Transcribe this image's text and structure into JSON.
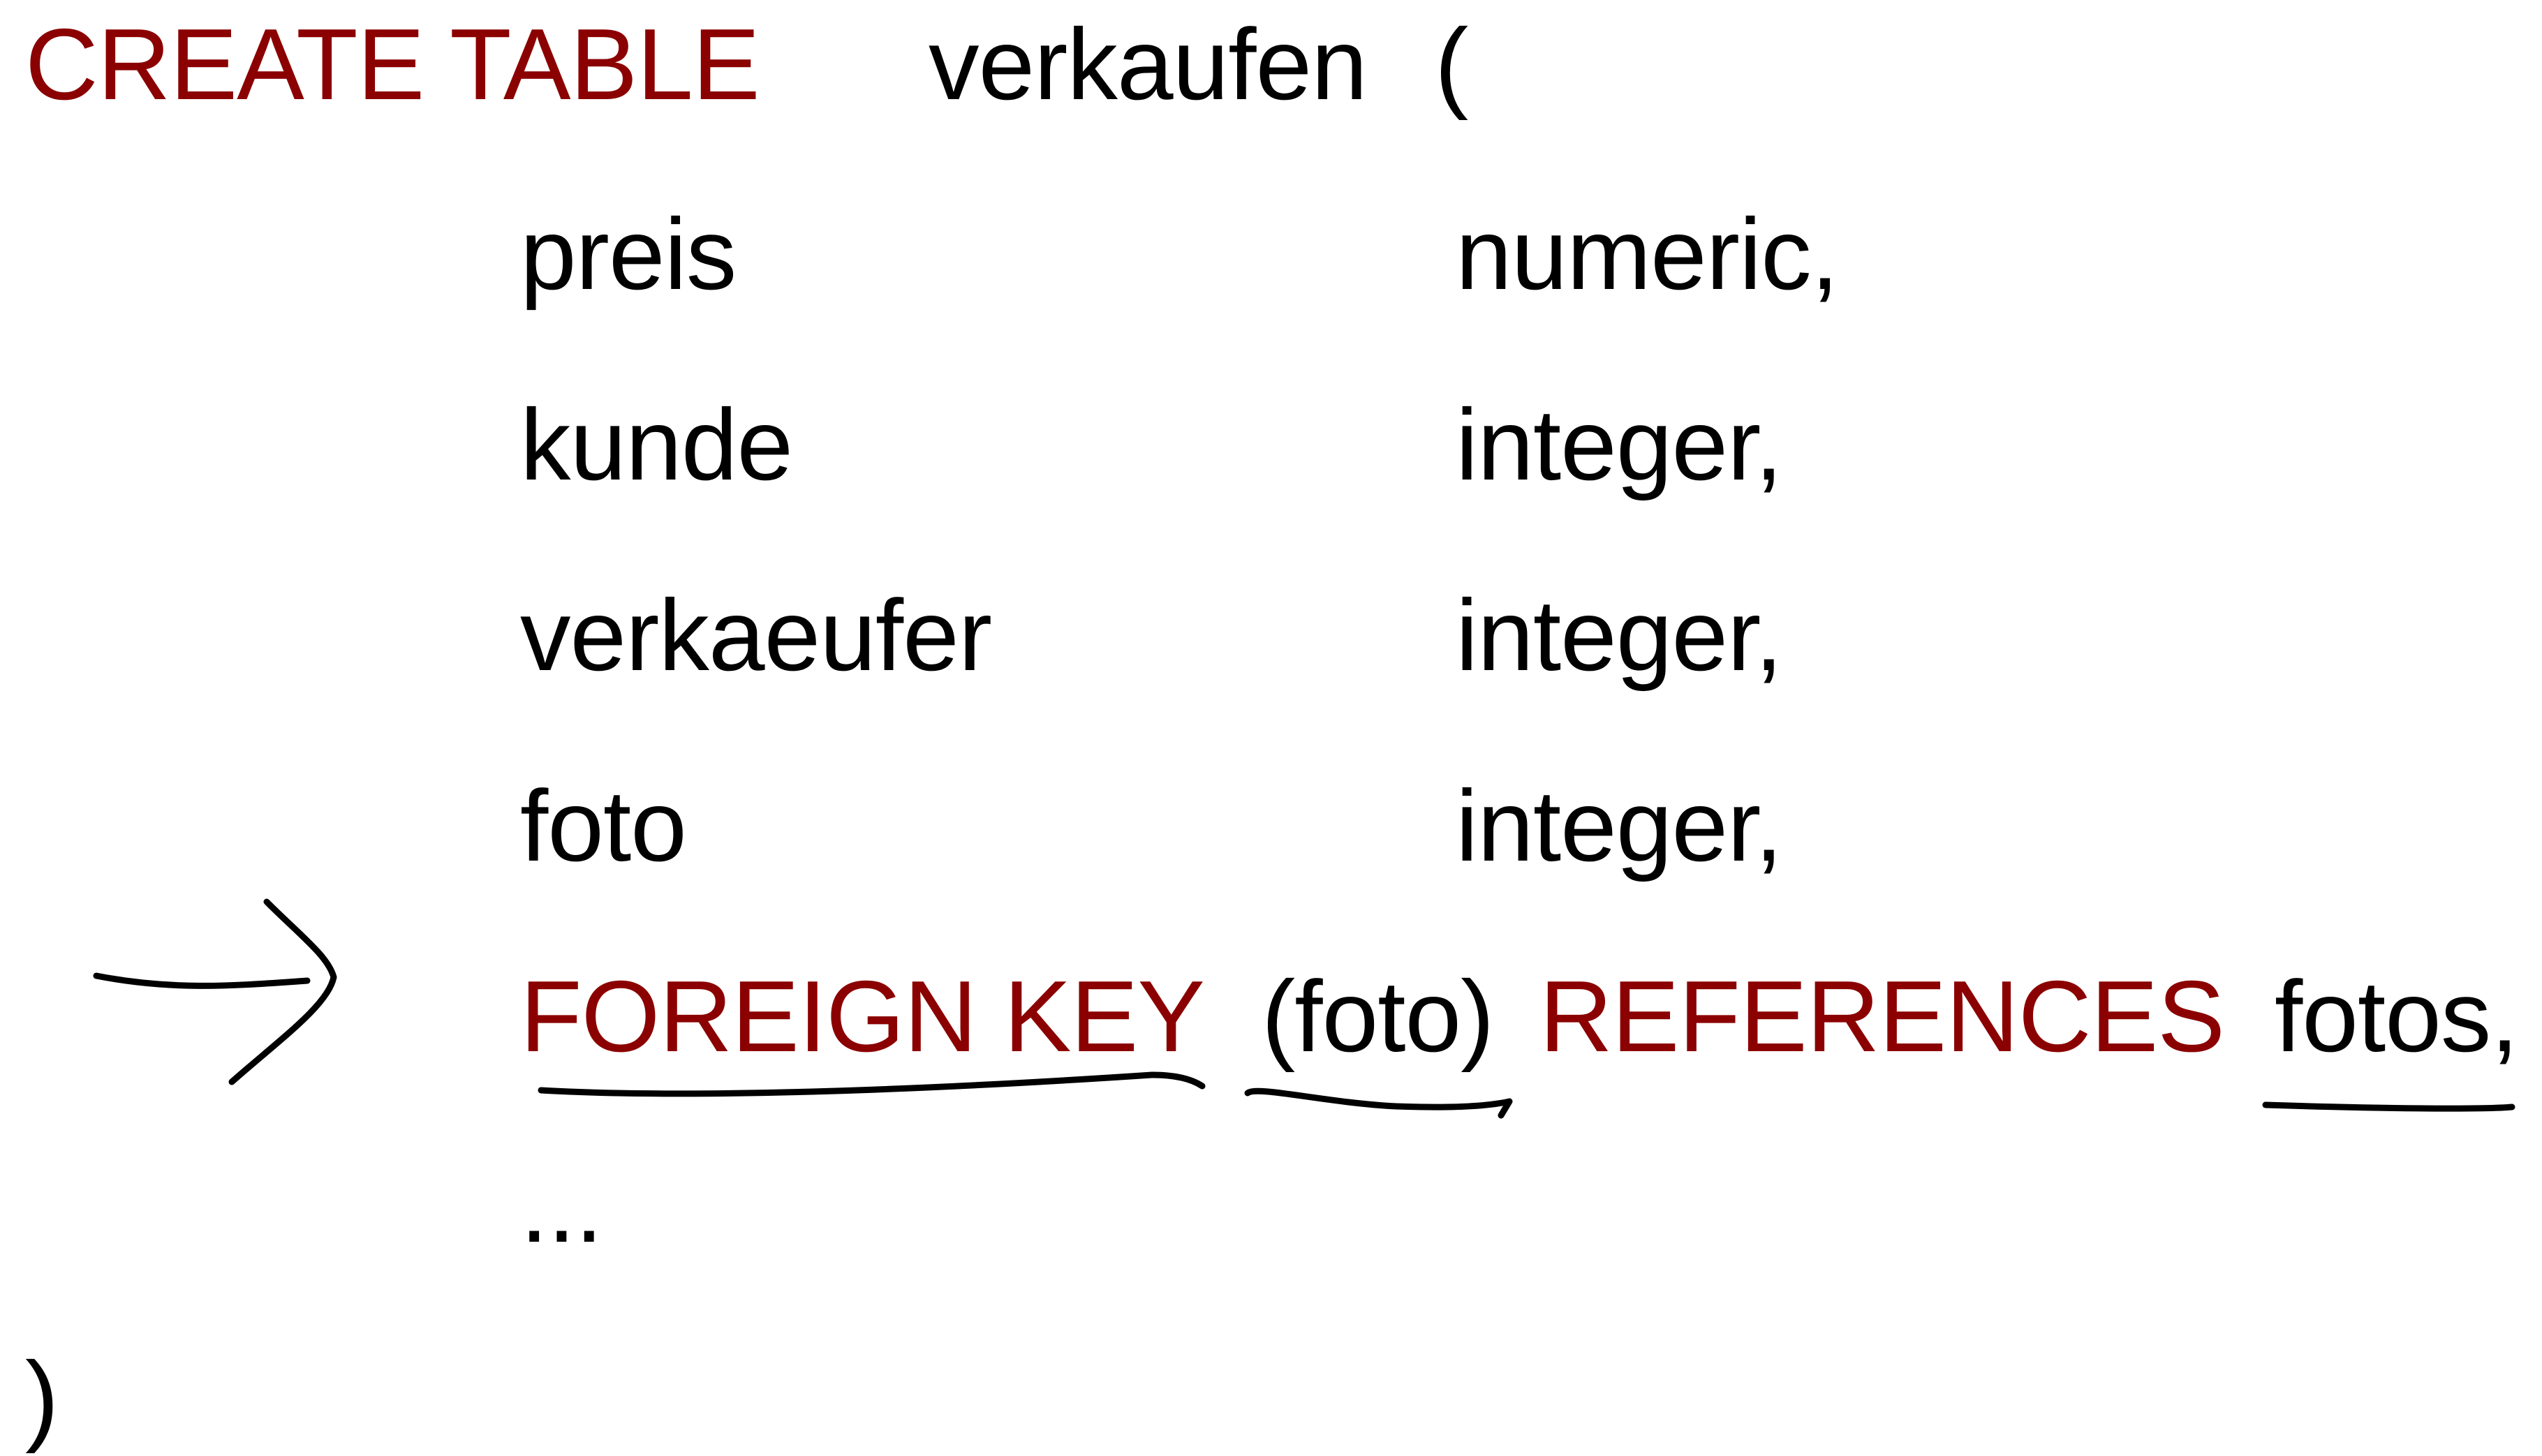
{
  "colors": {
    "keyword": "#8b0000",
    "text": "#000000",
    "background": "#ffffff",
    "ink": "#000000"
  },
  "sql": {
    "create_table_keyword": "CREATE TABLE",
    "table_name": "verkaufen",
    "open_paren": "(",
    "columns": [
      {
        "name": "preis",
        "type": "numeric,"
      },
      {
        "name": "kunde",
        "type": "integer,"
      },
      {
        "name": "verkaeufer",
        "type": "integer,"
      },
      {
        "name": "foto",
        "type": "integer,"
      }
    ],
    "foreign_key": {
      "keyword": "FOREIGN KEY",
      "column": "(foto)",
      "references_keyword": "REFERENCES",
      "referenced_table": "fotos,"
    },
    "ellipsis": "...",
    "close_paren": ")"
  },
  "annotations": {
    "pointer_icon": "hand-drawn-arrow-icon",
    "underlines": [
      "foreign-key-keyword",
      "foreign-key-column",
      "referenced-table"
    ]
  }
}
